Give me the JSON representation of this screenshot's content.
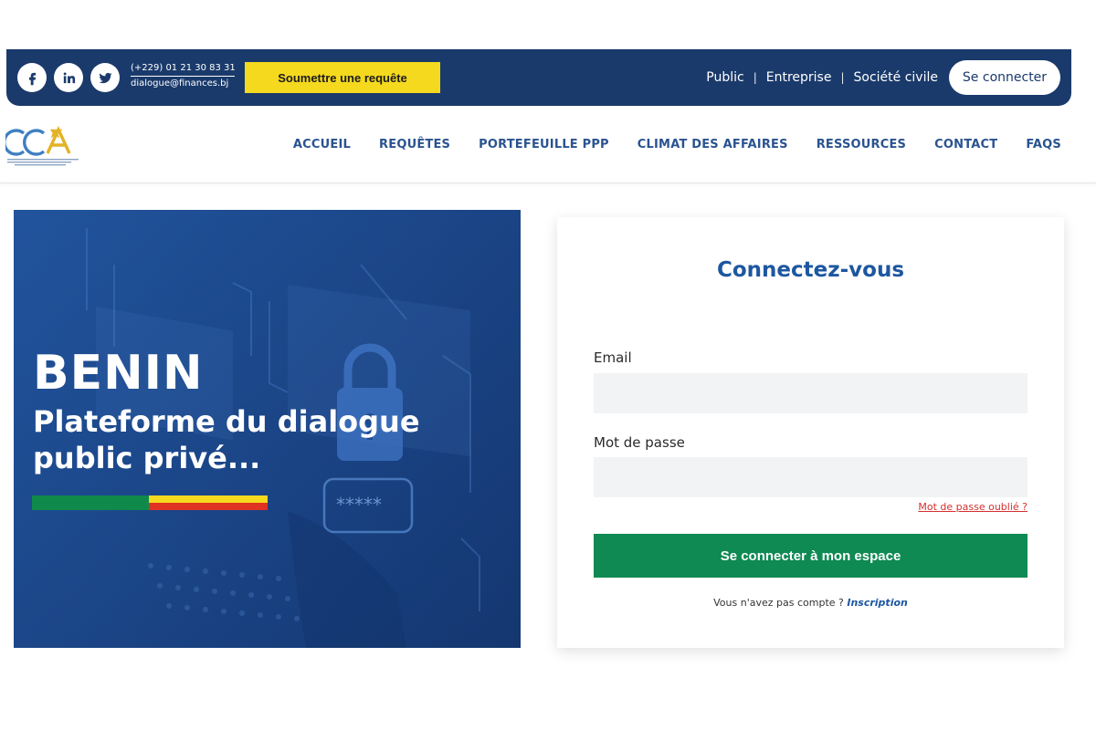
{
  "topbar": {
    "social_icons": [
      "facebook-icon",
      "linkedin-icon",
      "twitter-icon"
    ],
    "phone": "(+229) 01 21 30 83 31",
    "email": "dialogue@finances.bj",
    "submit_request_label": "Soumettre une requête",
    "audiences": [
      "Public",
      "Entreprise",
      "Société civile"
    ],
    "separator": "|",
    "login_label": "Se connecter",
    "colors": {
      "bar": "#1a3a6b",
      "cta": "#f5d91e"
    }
  },
  "header": {
    "logo_text": "CCA",
    "nav": [
      "ACCUEIL",
      "REQUÊTES",
      "PORTEFEUILLE PPP",
      "CLIMAT DES AFFAIRES",
      "RESSOURCES",
      "CONTACT",
      "FAQS"
    ]
  },
  "hero": {
    "title": "BENIN",
    "subtitle": "Plateforme du dialogue public privé...",
    "image_password_mask": "*****",
    "flag_colors": [
      "#0f8a4a",
      "#f5d91e",
      "#e03222"
    ]
  },
  "login": {
    "title": "Connectez-vous",
    "email_label": "Email",
    "email_value": "",
    "password_label": "Mot de passe",
    "password_value": "",
    "forgot_label": "Mot de passe oublié ?",
    "submit_label": "Se connecter à mon espace",
    "signup_prompt": "Vous n'avez pas compte ?",
    "signup_link": "Inscription",
    "colors": {
      "title": "#1d57a0",
      "submit": "#0e8a52",
      "forgot": "#d32f2f"
    }
  }
}
